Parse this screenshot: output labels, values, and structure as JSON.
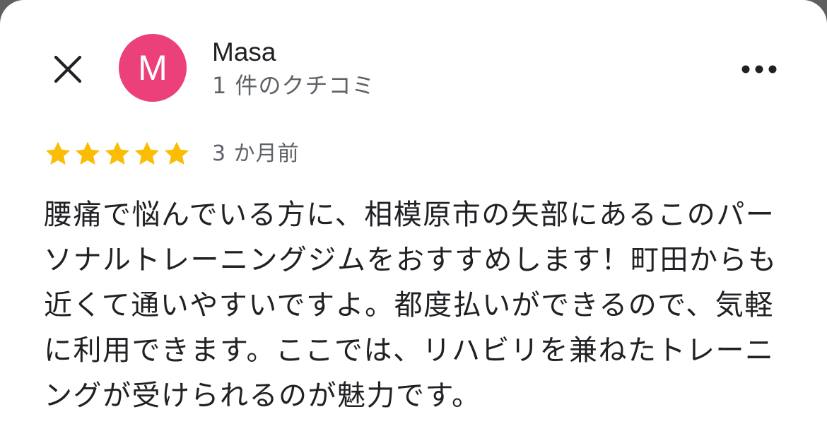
{
  "header": {
    "close_icon": "close-icon",
    "more_icon": "more-horizontal-icon"
  },
  "reviewer": {
    "avatar_letter": "M",
    "avatar_color": "#ec407a",
    "name": "Masa",
    "review_count_label": "1 件のクチコミ"
  },
  "review": {
    "rating": 5,
    "max_rating": 5,
    "star_color": "#fbbc04",
    "date": "3 か月前",
    "text": "腰痛で悩んでいる方に、相模原市の矢部にあるこのパーソナルトレーニングジムをおすすめします！町田からも近くて通いやすいですよ。都度払いができるので、気軽に利用できます。ここでは、リハビリを兼ねたトレーニングが受けられるのが魅力です。"
  }
}
